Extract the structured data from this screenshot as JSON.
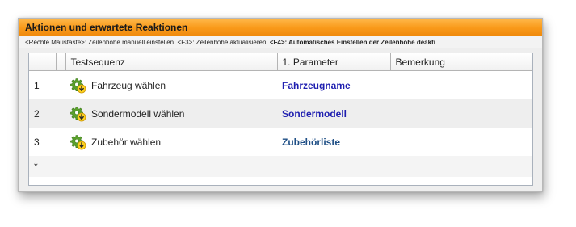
{
  "panel": {
    "title": "Aktionen und erwartete Reaktionen",
    "hint_normal": "<Rechte Maustaste>: Zeilenhöhe manuell einstellen. <F3>: Zeilenhöhe aktualisieren. ",
    "hint_bold": "<F4>: Automatisches Einstellen der Zeilenhöhe deakti",
    "accent_color": "#f99a1a"
  },
  "grid": {
    "columns": [
      "",
      "Testsequenz",
      "1. Parameter",
      "Bemerkung"
    ],
    "rows": [
      {
        "index": "1",
        "sequence": "Fahrzeug wählen",
        "parameter": "Fahrzeugname",
        "remark": "",
        "icon": "gear-arrow-icon"
      },
      {
        "index": "2",
        "sequence": "Sondermodell wählen",
        "parameter": "Sondermodell",
        "remark": "",
        "icon": "gear-arrow-icon"
      },
      {
        "index": "3",
        "sequence": "Zubehör wählen",
        "parameter": "Zubehörliste",
        "remark": "",
        "icon": "gear-arrow-icon"
      }
    ],
    "new_row_marker": "*"
  }
}
